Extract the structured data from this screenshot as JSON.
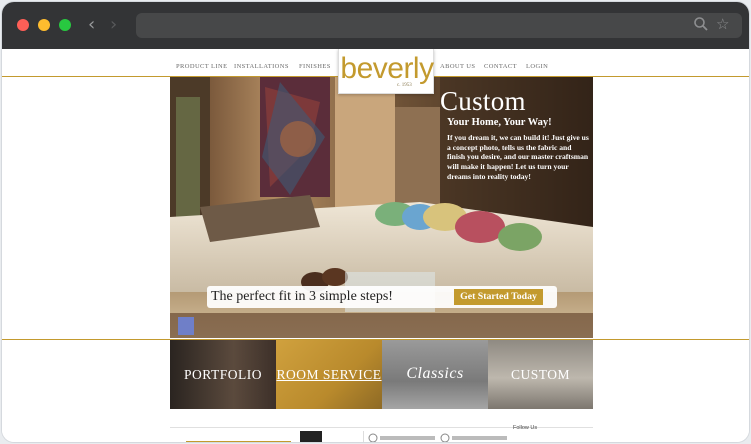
{
  "browser": {
    "back_glyph": "‹",
    "forward_glyph": "›",
    "star_glyph": "☆"
  },
  "nav": {
    "items": [
      "PRODUCT LINE",
      "INSTALLATIONS",
      "FINISHES",
      "ABOUT US",
      "CONTACT",
      "LOGIN"
    ]
  },
  "logo": {
    "word": "beverly",
    "since": "c. 1953"
  },
  "hero": {
    "title": "Custom",
    "subtitle": "Your Home, Your Way!",
    "body": "If you dream it, we can build it! Just give us a concept photo, tells us the fabric and finish you desire, and our master craftsman will make it happen! Let us turn your dreams into reality today!",
    "steps_text": "The perfect fit in 3 simple steps!",
    "cta": "Get Started Today"
  },
  "categories": [
    "PORTFOLIO",
    "ROOM SERVICE",
    "Classics",
    "CUSTOM"
  ],
  "footer": {
    "follow": "Follow Us"
  },
  "colors": {
    "gold": "#c39a2e",
    "titlebar": "#333436"
  }
}
